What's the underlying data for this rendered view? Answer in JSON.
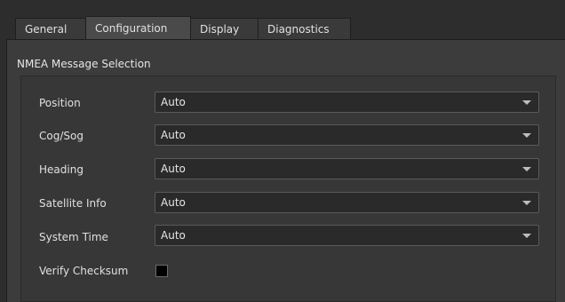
{
  "tabs": [
    {
      "label": "General"
    },
    {
      "label": "Configuration"
    },
    {
      "label": "Display"
    },
    {
      "label": "Diagnostics"
    }
  ],
  "active_tab": "Configuration",
  "group": {
    "title": "NMEA Message Selection"
  },
  "rows": [
    {
      "label": "Position",
      "value": "Auto"
    },
    {
      "label": "Cog/Sog",
      "value": "Auto"
    },
    {
      "label": "Heading",
      "value": "Auto"
    },
    {
      "label": "Satellite Info",
      "value": "Auto"
    },
    {
      "label": "System Time",
      "value": "Auto"
    }
  ],
  "verify_checksum": {
    "label": "Verify Checksum",
    "checked": false
  },
  "icons": {
    "combo_arrow": "chevron-down-icon"
  },
  "colors": {
    "background": "#2d2d2d",
    "panel": "#3c3c3c",
    "group": "#373737",
    "combo": "#2a2a2a"
  }
}
